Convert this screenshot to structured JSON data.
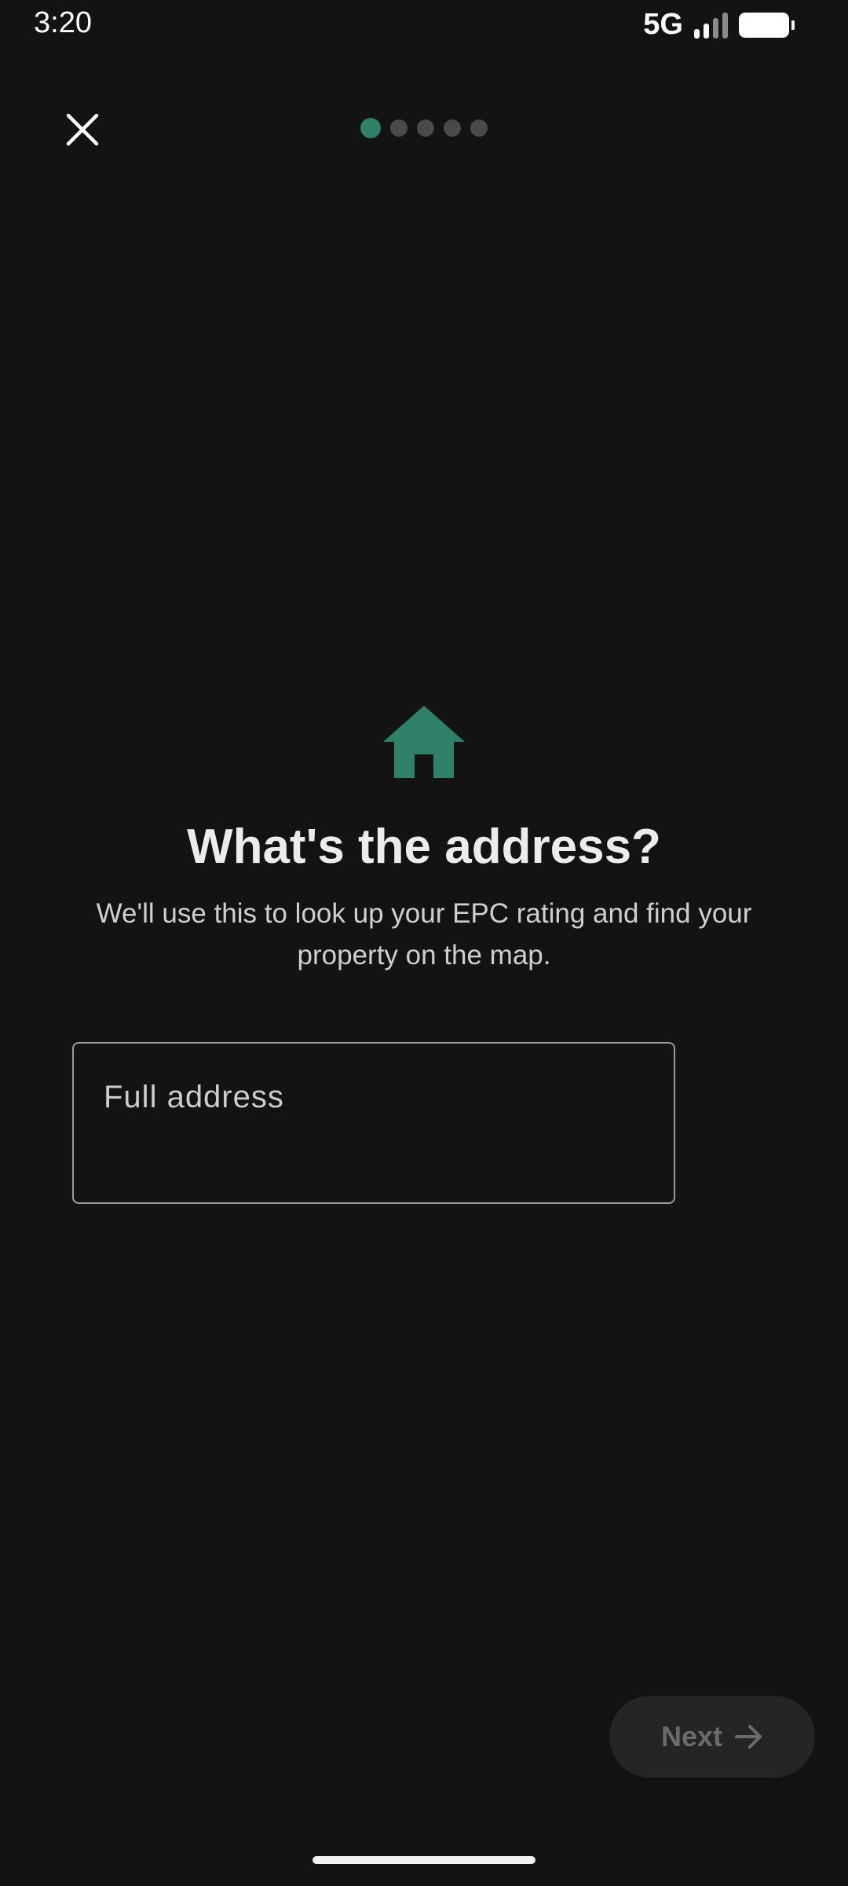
{
  "status_bar": {
    "time": "3:20",
    "network": "5G",
    "signal_icon": "signal-bars-icon",
    "battery_icon": "battery-icon"
  },
  "top_bar": {
    "close_icon": "close-icon",
    "progress": {
      "total_steps": 5,
      "current_step": 1,
      "active_color": "#2e8068",
      "inactive_color": "#4a4a4c"
    }
  },
  "hero": {
    "icon": "house-icon",
    "icon_color": "#2e8068",
    "title": "What's the address?",
    "subtitle_line1": "We'll use this to look up your EPC rating and find your",
    "subtitle_line2": "property on the map."
  },
  "address_input": {
    "placeholder": "Full address",
    "value": ""
  },
  "footer": {
    "next_label": "Next",
    "next_icon": "arrow-right-icon",
    "next_enabled": false
  }
}
